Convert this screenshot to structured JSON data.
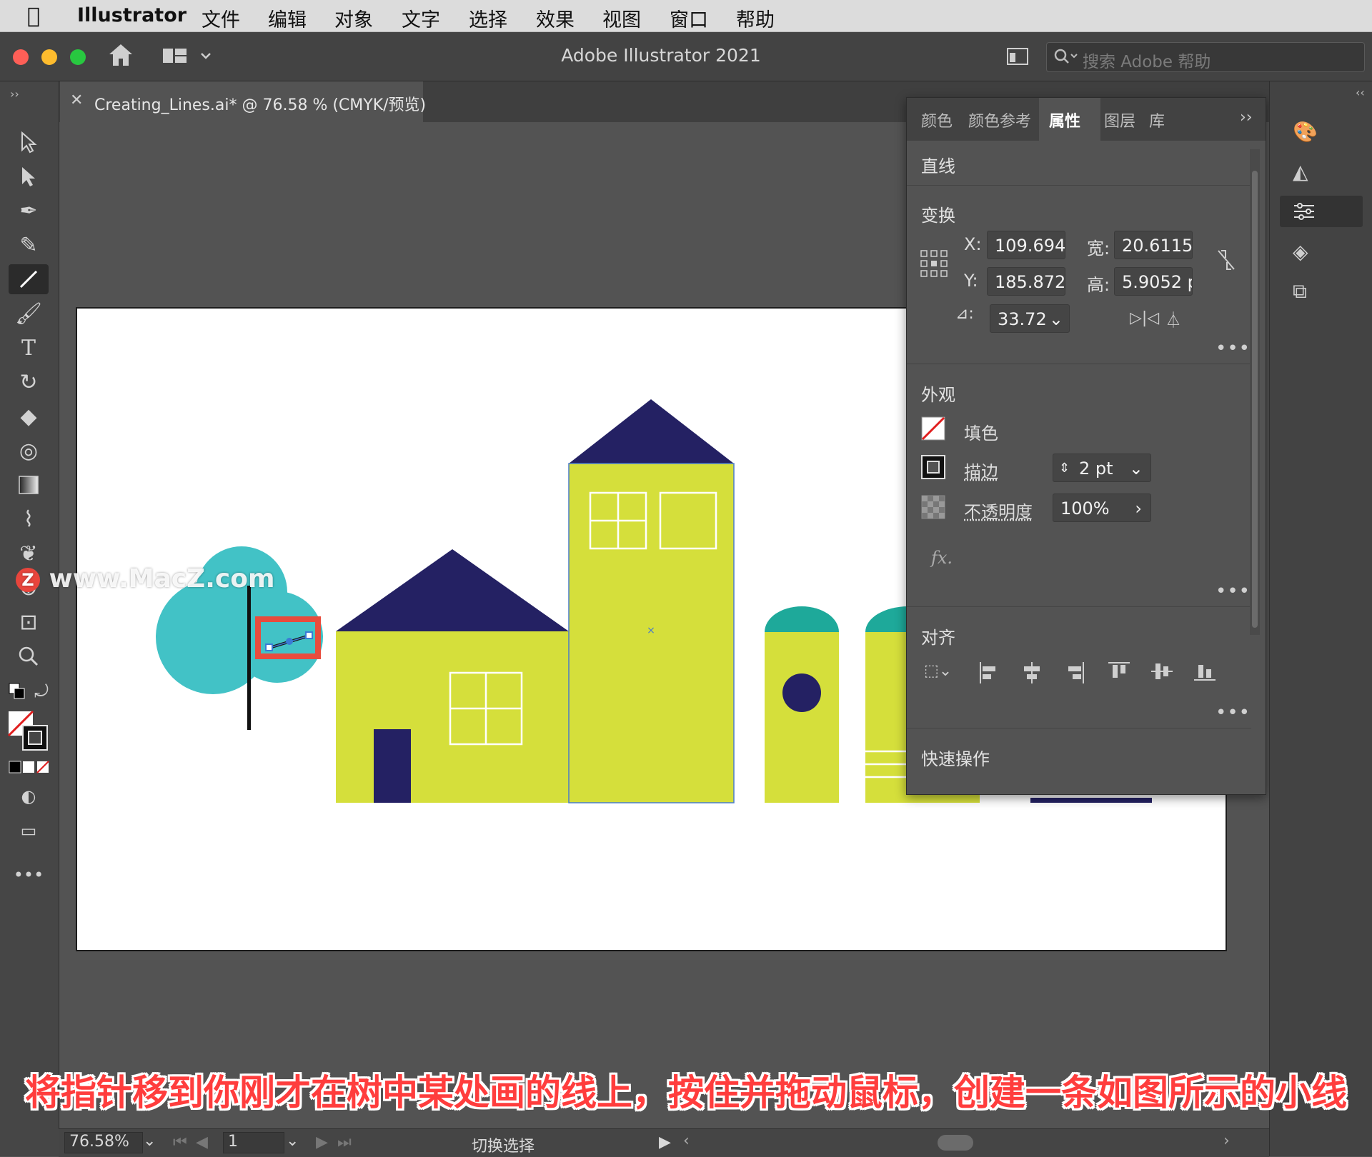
{
  "menubar": {
    "app": "Illustrator",
    "items": [
      "文件",
      "编辑",
      "对象",
      "文字",
      "选择",
      "效果",
      "视图",
      "窗口",
      "帮助"
    ]
  },
  "titlebar": {
    "title": "Adobe Illustrator 2021",
    "search_placeholder": "搜索 Adobe 帮助"
  },
  "document": {
    "tab_label": "Creating_Lines.ai* @ 76.58 % (CMYK/预览)"
  },
  "panel": {
    "tabs": [
      "颜色",
      "颜色参考",
      "属性",
      "图层",
      "库"
    ],
    "active_tab": "属性",
    "object_type": "直线",
    "transform": {
      "title": "变换",
      "x_label": "X:",
      "x_value": "109.694",
      "y_label": "Y:",
      "y_value": "185.872",
      "w_label": "宽:",
      "w_value": "20.6115",
      "h_label": "高:",
      "h_value": "5.9052 p",
      "angle_label": "⊿:",
      "angle_value": "33.72"
    },
    "appearance": {
      "title": "外观",
      "fill_label": "填色",
      "stroke_label": "描边",
      "stroke_value": "2 pt",
      "opacity_label": "不透明度",
      "opacity_value": "100%",
      "fx_label": "fx."
    },
    "align": {
      "title": "对齐"
    },
    "quick_actions": {
      "title": "快速操作"
    }
  },
  "statusbar": {
    "zoom": "76.58%",
    "artboard_number": "1",
    "mode": "切换选择"
  },
  "caption": "将指针移到你刚才在树中某处画的线上，按住并拖动鼠标，创建一条如图所示的小线",
  "watermark": "www.MacZ.com",
  "colors": {
    "navy": "#242163",
    "lime": "#d5df3b",
    "teal": "#42c2c6",
    "teal_dark": "#1ea99a",
    "highlight": "#e84c3d"
  }
}
